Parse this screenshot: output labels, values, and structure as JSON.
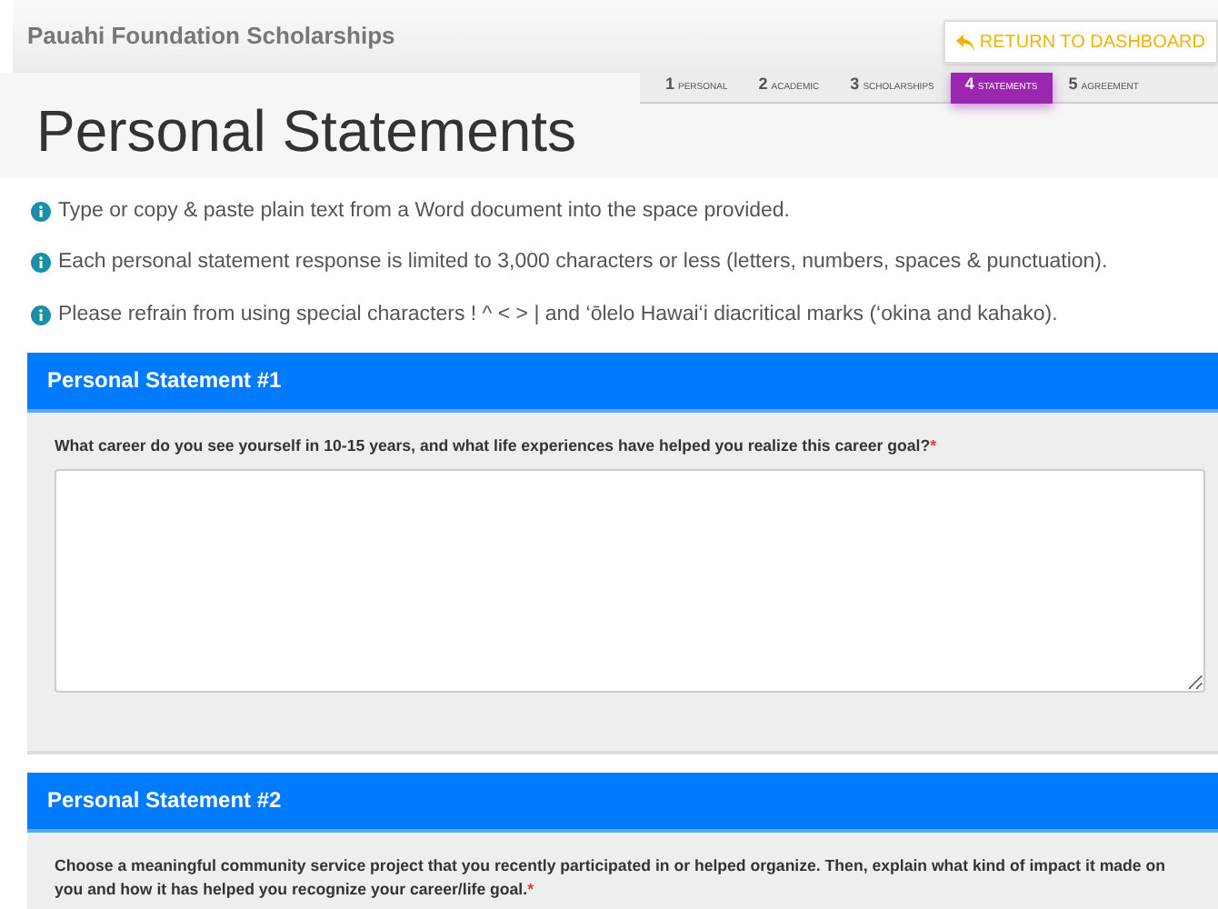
{
  "header": {
    "title": "Pauahi Foundation Scholarships",
    "return_button": "RETURN TO DASHBOARD"
  },
  "steps": [
    {
      "number": "1",
      "label": "PERSONAL",
      "selected": false
    },
    {
      "number": "2",
      "label": "ACADEMIC",
      "selected": false
    },
    {
      "number": "3",
      "label": "SCHOLARSHIPS",
      "selected": false
    },
    {
      "number": "4",
      "label": "STATEMENTS",
      "selected": true
    },
    {
      "number": "5",
      "label": "AGREEMENT",
      "selected": false
    }
  ],
  "page_title": "Personal Statements",
  "notes": [
    "Type or copy & paste plain text from a Word document into the space provided.",
    "Each personal statement response is limited to 3,000 characters or less (letters, numbers, spaces & punctuation).",
    "Please refrain from using special characters ! ^ < > | and ‘ōlelo Hawai‘i diacritical marks (‘okina and kahako)."
  ],
  "panels": [
    {
      "title": "Personal Statement #1",
      "question": "What career do you see yourself in 10-15 years, and what life experiences have helped you realize this career goal?",
      "required_mark": "*"
    },
    {
      "title": "Personal Statement #2",
      "question": "Choose a meaningful community service project that you recently participated in or helped organize. Then, explain what kind of impact it made on you and how it has helped you recognize your career/life goal.",
      "required_mark": "*"
    }
  ]
}
